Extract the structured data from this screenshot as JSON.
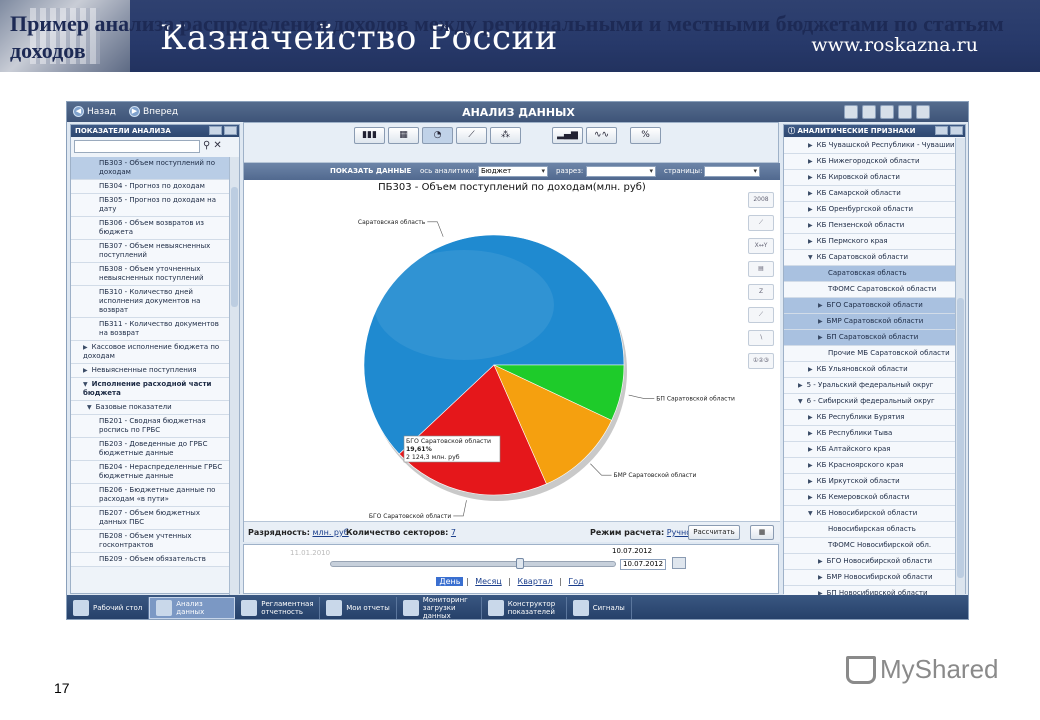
{
  "slide": {
    "title": "Пример анализа распределения доходов между региональными и местными бюджетами по статьям доходов",
    "brand": "Казначейство России",
    "site": "www.roskazna.ru",
    "page_number": "17",
    "footer_logo": "MyShared"
  },
  "app": {
    "back": "Назад",
    "forward": "Вперед",
    "title": "АНАЛИЗ ДАННЫХ"
  },
  "left_panel": {
    "header": "ПОКАЗАТЕЛИ АНАЛИЗА",
    "search_value": "",
    "rows": [
      {
        "text": "ПБ303 - Объем поступлений по доходам",
        "kind": "sel"
      },
      {
        "text": "ПБ304 - Прогноз по доходам",
        "kind": "item"
      },
      {
        "text": "ПБ305 - Прогноз по доходам на дату",
        "kind": "item"
      },
      {
        "text": "ПБ306 - Объем возвратов из бюджета",
        "kind": "item"
      },
      {
        "text": "ПБ307 - Объем невыясненных поступлений",
        "kind": "item"
      },
      {
        "text": "ПБ308 - Объем уточненных невыясненных поступлений",
        "kind": "item"
      },
      {
        "text": "ПБ310 - Количество дней исполнения документов на возврат",
        "kind": "item"
      },
      {
        "text": "ПБ311 - Количество документов на возврат",
        "kind": "item"
      },
      {
        "text": "Кассовое исполнение бюджета по доходам",
        "kind": "grp"
      },
      {
        "text": "Невыясненные поступления",
        "kind": "grp"
      },
      {
        "text": "Исполнение расходной части бюджета",
        "kind": "open"
      },
      {
        "text": "Базовые показатели",
        "kind": "subopen"
      },
      {
        "text": "ПБ201 - Сводная бюджетная роспись по ГРБС",
        "kind": "item"
      },
      {
        "text": "ПБ203 - Доведенные до ГРБС бюджетные данные",
        "kind": "item"
      },
      {
        "text": "ПБ204 - Нераспределенные ГРБС бюджетные данные",
        "kind": "item"
      },
      {
        "text": "ПБ206 - Бюджетные данные по расходам «в пути»",
        "kind": "item"
      },
      {
        "text": "ПБ207 - Объем бюджетных данных ПБС",
        "kind": "item"
      },
      {
        "text": "ПБ208 - Объем учтенных госконтрактов",
        "kind": "item"
      },
      {
        "text": "ПБ209 - Объем обязательств",
        "kind": "item"
      }
    ]
  },
  "center": {
    "show_data": "ПОКАЗАТЬ ДАННЫЕ",
    "axis_label": "ось аналитики:",
    "axis_value": "Бюджет",
    "section_label": "разрез:",
    "pages_label": "страницы:",
    "percent": "%",
    "precision_label": "Разрядность:",
    "precision_value": "млн. руб",
    "sectors_label": "Количество секторов:",
    "sectors_value": "7",
    "mode_label": "Режим расчета:",
    "mode_value": "Ручной",
    "calc_button": "Рассчитать"
  },
  "chart_data": {
    "type": "pie",
    "title": "ПБ303 - Объем поступлений по доходам(млн. руб)",
    "categories": [
      "Саратовская область",
      "БП Саратовской области",
      "БМР Саратовской области",
      "БГО Саратовской области"
    ],
    "values": [
      62,
      7,
      11.39,
      19.61
    ],
    "colors": [
      "#1f8ad0",
      "#1ecb2a",
      "#f5a00f",
      "#e5171b"
    ],
    "tooltip": {
      "name": "БГО Саратовской области",
      "percent": "19,61%",
      "amount": "2 124,3 млн. руб"
    }
  },
  "timeline": {
    "start_date": "11.01.2010",
    "current_date": "10.07.2012",
    "date_value": "10.07.2012",
    "periods": [
      "День",
      "Месяц",
      "Квартал",
      "Год"
    ],
    "active_period": "День"
  },
  "right_panel": {
    "header": "АНАЛИТИЧЕСКИЕ ПРИЗНАКИ",
    "rows": [
      {
        "text": "КБ Чувашской Республики - Чувашии",
        "indent": 3,
        "tri": true
      },
      {
        "text": "КБ Нижегородской области",
        "indent": 3,
        "tri": true
      },
      {
        "text": "КБ Кировской области",
        "indent": 3,
        "tri": true
      },
      {
        "text": "КБ Самарской области",
        "indent": 3,
        "tri": true
      },
      {
        "text": "КБ Оренбургской области",
        "indent": 3,
        "tri": true
      },
      {
        "text": "КБ Пензенской области",
        "indent": 3,
        "tri": true
      },
      {
        "text": "КБ Пермского края",
        "indent": 3,
        "tri": true
      },
      {
        "text": "КБ Саратовской области",
        "indent": 3,
        "tri": true,
        "open": true
      },
      {
        "text": "Саратовская область",
        "indent": 5,
        "sel": true
      },
      {
        "text": "ТФОМС Саратовской области",
        "indent": 5
      },
      {
        "text": "БГО Саратовской области",
        "indent": 4,
        "tri": true,
        "sel": true
      },
      {
        "text": "БМР Саратовской области",
        "indent": 4,
        "tri": true,
        "sel": true
      },
      {
        "text": "БП Саратовской области",
        "indent": 4,
        "tri": true,
        "sel": true
      },
      {
        "text": "Прочие МБ Саратовской области",
        "indent": 5
      },
      {
        "text": "КБ Ульяновской области",
        "indent": 3,
        "tri": true
      },
      {
        "text": "5 - Уральский федеральный округ",
        "indent": 2,
        "tri": true
      },
      {
        "text": "6 - Сибирский федеральный округ",
        "indent": 2,
        "tri": true,
        "open": true
      },
      {
        "text": "КБ Республики Бурятия",
        "indent": 3,
        "tri": true
      },
      {
        "text": "КБ Республики Тыва",
        "indent": 3,
        "tri": true
      },
      {
        "text": "КБ Алтайского края",
        "indent": 3,
        "tri": true
      },
      {
        "text": "КБ Красноярского края",
        "indent": 3,
        "tri": true
      },
      {
        "text": "КБ Иркутской области",
        "indent": 3,
        "tri": true
      },
      {
        "text": "КБ Кемеровской области",
        "indent": 3,
        "tri": true
      },
      {
        "text": "КБ Новосибирской области",
        "indent": 3,
        "tri": true,
        "open": true
      },
      {
        "text": "Новосибирская область",
        "indent": 5
      },
      {
        "text": "ТФОМС Новосибирской обл.",
        "indent": 5
      },
      {
        "text": "БГО Новосибирской области",
        "indent": 4,
        "tri": true
      },
      {
        "text": "БМР Новосибирской области",
        "indent": 4,
        "tri": true
      },
      {
        "text": "БП Новосибирской области",
        "indent": 4,
        "tri": true
      }
    ]
  },
  "taskbar": [
    {
      "label": "Рабочий стол",
      "active": false,
      "icon": "desktop-icon"
    },
    {
      "label": "Анализ данных",
      "active": true,
      "icon": "chart-icon"
    },
    {
      "label": "Регламентная отчетность",
      "active": false,
      "icon": "checklist-icon"
    },
    {
      "label": "Мои отчеты",
      "active": false,
      "icon": "star-icon"
    },
    {
      "label": "Мониторинг загрузки данных",
      "active": false,
      "icon": "database-icon"
    },
    {
      "label": "Конструктор показателей",
      "active": false,
      "icon": "formula-icon"
    },
    {
      "label": "Сигналы",
      "active": false,
      "icon": "alert-icon"
    }
  ]
}
